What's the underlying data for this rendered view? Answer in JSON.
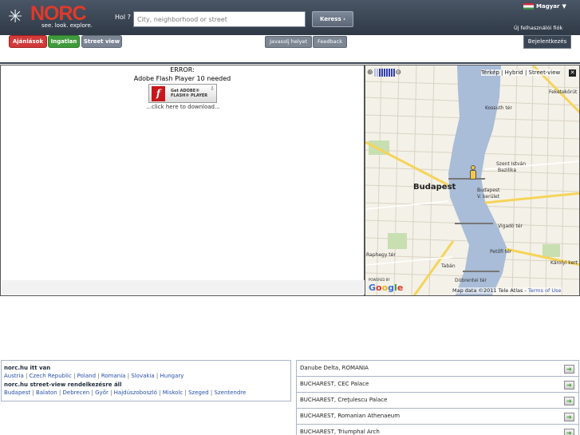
{
  "header": {
    "logo_text": "NORC",
    "tagline": "see. look. explore.",
    "search_label": "Hol ?",
    "search_placeholder": "City, neighborhood or street",
    "search_button": "Keress",
    "language": "Magyar",
    "language_arrow": "▼",
    "new_user_link": "Új felhasználói fiók"
  },
  "tabs": {
    "offers": "Ajánlások",
    "real_estate": "Ingatlan",
    "street_view": "Street view",
    "suggest_place": "Javasolj helyet",
    "feedback": "Feedback",
    "report": "Bejelentkezés"
  },
  "flash": {
    "error_title": "ERROR:",
    "error_message": "Adobe Flash Player 10 needed",
    "badge_line1": "Get ADOBE®",
    "badge_line2": "FLASH® PLAYER",
    "download_text": "...click here to download..."
  },
  "map": {
    "type_links": "Térkép | Hybrid | Street-view",
    "city_label": "Budapest",
    "labels": [
      "Kossuth tér",
      "Szent István",
      "Bazilika",
      "Budapest",
      "V. kerület",
      "Vigadó tér",
      "Petőfi tér",
      "Tabán",
      "Döbrentei tér",
      "Károlyi kert",
      "Raphegy tér",
      "Feketekörút"
    ],
    "copyright": "Map data ©2011 Tele Atlas - ",
    "terms": "Terms of Use",
    "powered_by": "POWERED BY",
    "google": "Google",
    "colors": {
      "water": "#a9bcd8",
      "land": "#f4f1e8",
      "road_major": "#f5d45a",
      "road_minor": "#ffffff",
      "park": "#c8dfb2"
    }
  },
  "info": {
    "norc_here_title": "norc.hu itt van",
    "countries": [
      "Austria",
      "Czech Republic",
      "Poland",
      "Romania",
      "Slovakia",
      "Hungary"
    ],
    "streetview_title": "norc.hu street-view rendelkezésre áll",
    "cities": [
      "Budapest",
      "Balaton",
      "Debrecen",
      "Győr",
      "Hajdúszoboszló",
      "Miskolc",
      "Szeged",
      "Szentendre"
    ]
  },
  "locations": [
    "Danube Delta, ROMANIA",
    "BUCHAREST, CEC Palace",
    "BUCHAREST, Creţulescu Palace",
    "BUCHAREST, Romanian Athenaeum",
    "BUCHAREST, Triumphal Arch"
  ]
}
